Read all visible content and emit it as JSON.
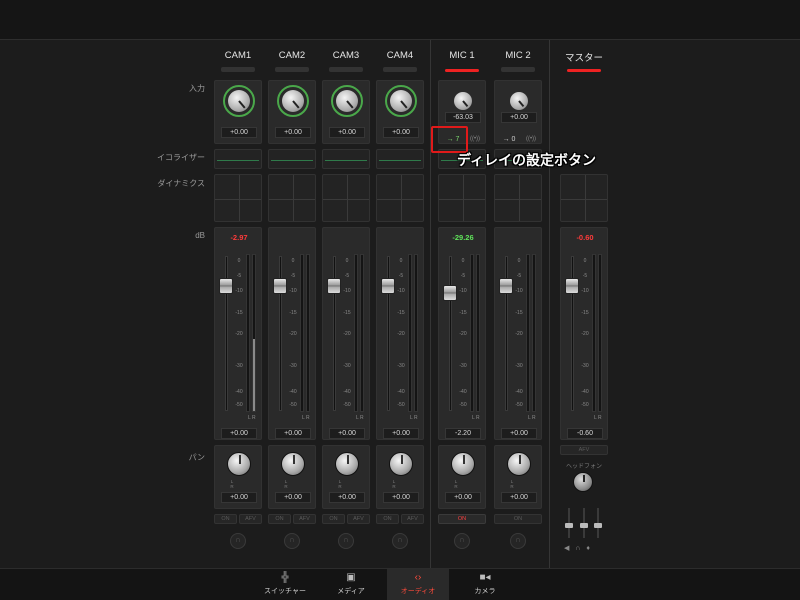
{
  "row_labels": {
    "input": "入力",
    "equalizer": "イコライザー",
    "dynamics": "ダイナミクス",
    "db": "dB",
    "pan": "パン"
  },
  "channels": [
    {
      "name": "CAM1",
      "gain": "+0.00",
      "peak": "-2.97",
      "peak_color": "red",
      "fader": "+0.00",
      "pan": "+0.00",
      "on": "ON",
      "afv": "AFV"
    },
    {
      "name": "CAM2",
      "gain": "+0.00",
      "peak": "",
      "peak_color": "red",
      "fader": "+0.00",
      "pan": "+0.00",
      "on": "ON",
      "afv": "AFV"
    },
    {
      "name": "CAM3",
      "gain": "+0.00",
      "peak": "",
      "peak_color": "red",
      "fader": "+0.00",
      "pan": "+0.00",
      "on": "ON",
      "afv": "AFV"
    },
    {
      "name": "CAM4",
      "gain": "+0.00",
      "peak": "",
      "peak_color": "red",
      "fader": "+0.00",
      "pan": "+0.00",
      "on": "ON",
      "afv": "AFV"
    },
    {
      "name": "MIC 1",
      "gain": "-63.03",
      "delay": "→ 7",
      "peak": "-29.26",
      "peak_color": "green",
      "fader": "-2.20",
      "pan": "+0.00",
      "on": "ON"
    },
    {
      "name": "MIC 2",
      "gain": "+0.00",
      "delay": "→ 0",
      "peak": "",
      "peak_color": "green",
      "fader": "+0.00",
      "pan": "+0.00",
      "on": "ON"
    }
  ],
  "master": {
    "name": "マスター",
    "peak": "-0.60",
    "fader": "-0.60",
    "afv": "AFV",
    "headphone_label": "ヘッドフォン"
  },
  "scale_ticks": [
    "0",
    "-5",
    "-10",
    "-15",
    "-20",
    "-30",
    "-40",
    "-50"
  ],
  "callout": "ディレイの設定ボタン",
  "tabs": [
    {
      "label": "スイッチャー",
      "icon": "switcher-icon",
      "active": false
    },
    {
      "label": "メディア",
      "icon": "media-icon",
      "active": false
    },
    {
      "label": "オーディオ",
      "icon": "audio-icon",
      "active": true
    },
    {
      "label": "カメラ",
      "icon": "camera-icon",
      "active": false
    }
  ],
  "colors": {
    "accent": "#ff4b3b",
    "peak_red": "#ff3b3b",
    "peak_green": "#5fe35a",
    "eq_line": "#2f7a4a"
  }
}
